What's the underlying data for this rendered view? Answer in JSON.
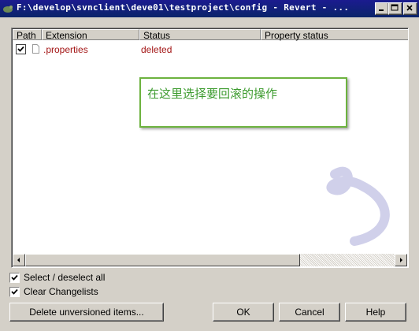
{
  "window": {
    "title": "F:\\develop\\svnclient\\deve01\\testproject\\config - Revert - ..."
  },
  "list": {
    "columns": [
      "Path",
      "Extension",
      "Status",
      "Property status"
    ],
    "rows": [
      {
        "checked": true,
        "path": "",
        "extension": ".properties",
        "status": "deleted",
        "property_status": ""
      }
    ],
    "row_text_color": "#a31515"
  },
  "annotation": {
    "text": "在这里选择要回滚的操作",
    "border_color": "#6db33f",
    "text_color": "#3c9b2e"
  },
  "options": {
    "select_all_label": "Select / deselect all",
    "select_all_checked": true,
    "clear_changelists_label": "Clear Changelists",
    "clear_changelists_checked": true
  },
  "buttons": {
    "delete_unversioned": "Delete unversioned items...",
    "ok": "OK",
    "cancel": "Cancel",
    "help": "Help"
  },
  "icons": {
    "app": "tortoise-icon",
    "minimize": "minimize-icon",
    "maximize": "maximize-icon",
    "close": "close-icon",
    "file": "file-icon",
    "checkmark": "checkmark-icon"
  }
}
